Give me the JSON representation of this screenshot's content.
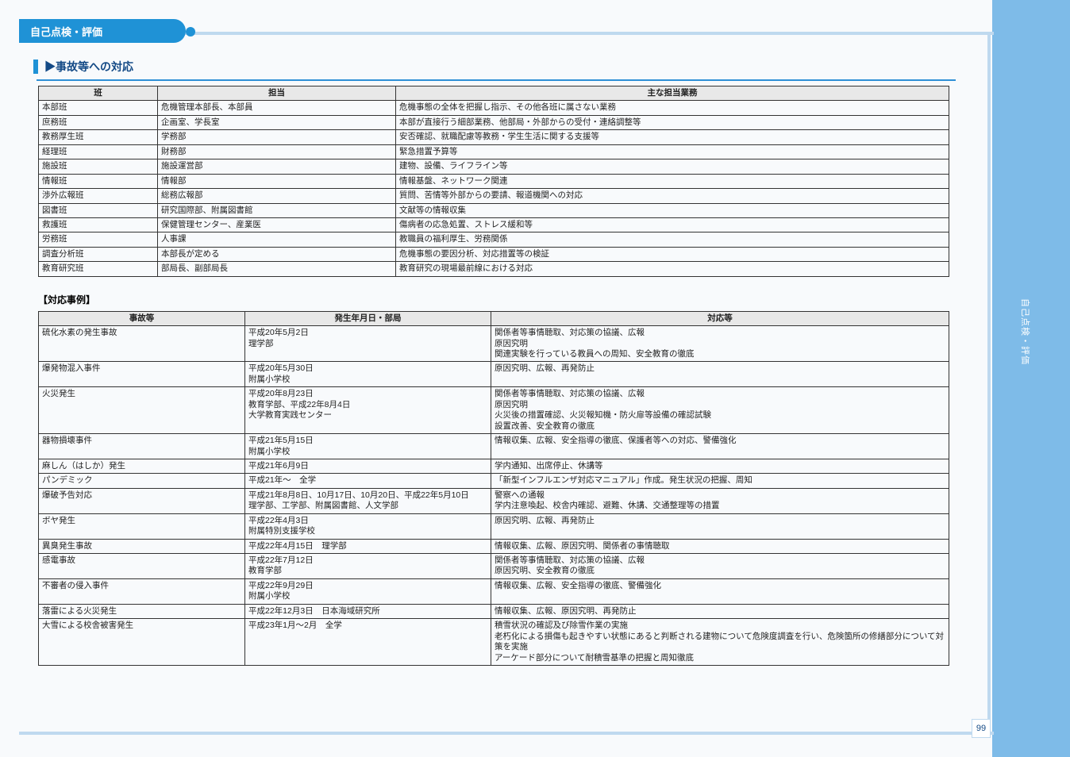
{
  "tab_label": "自己点検・評価",
  "side_label": "自己点検・評価",
  "page_number": "99",
  "section": {
    "title": "▶事故等への対応",
    "table_header": [
      "班",
      "担当",
      "主な担当業務"
    ],
    "rows": [
      [
        "本部班",
        "危機管理本部長、本部員",
        "危機事態の全体を把握し指示、その他各班に属さない業務"
      ],
      [
        "庶務班",
        "企画室、学長室",
        "本部が直接行う細部業務、他部局・外部からの受付・連絡調整等"
      ],
      [
        "教務厚生班",
        "学務部",
        "安否確認、就職配慮等教務・学生生活に関する支援等"
      ],
      [
        "経理班",
        "財務部",
        "緊急措置予算等"
      ],
      [
        "施設班",
        "施設運営部",
        "建物、設備、ライフライン等"
      ],
      [
        "情報班",
        "情報部",
        "情報基盤、ネットワーク関連"
      ],
      [
        "渉外広報班",
        "総務広報部",
        "質問、苦情等外部からの要請、報道機関への対応"
      ],
      [
        "図書班",
        "研究国際部、附属図書館",
        "文献等の情報収集"
      ],
      [
        "救護班",
        "保健管理センター、産業医",
        "傷病者の応急処置、ストレス緩和等"
      ],
      [
        "労務班",
        "人事課",
        "教職員の福利厚生、労務関係"
      ],
      [
        "調査分析班",
        "本部長が定める",
        "危機事態の要因分析、対応措置等の検証"
      ],
      [
        "教育研究班",
        "部局長、副部局長",
        "教育研究の現場最前線における対応"
      ]
    ]
  },
  "subhead": "【対応事例】",
  "table2": {
    "header": [
      "事故等",
      "発生年月日・部局",
      "対応等"
    ],
    "rows": [
      [
        "硫化水素の発生事故",
        "平成20年5月2日\n理学部",
        "関係者等事情聴取、対応策の協議、広報\n原因究明\n関連実験を行っている教員への周知、安全教育の徹底"
      ],
      [
        "爆発物混入事件",
        "平成20年5月30日\n附属小学校",
        "原因究明、広報、再発防止"
      ],
      [
        "火災発生",
        "平成20年8月23日\n教育学部、平成22年8月4日\n大学教育実践センター",
        "関係者等事情聴取、対応策の協議、広報\n原因究明\n火災後の措置確認、火災報知機・防火扉等設備の確認試験\n設置改善、安全教育の徹底"
      ],
      [
        "器物損壊事件",
        "平成21年5月15日\n附属小学校",
        "情報収集、広報、安全指導の徹底、保護者等への対応、警備強化"
      ],
      [
        "麻しん（はしか）発生",
        "平成21年6月9日",
        "学内通知、出席停止、休講等"
      ],
      [
        "パンデミック",
        "平成21年～　全学",
        "「新型インフルエンザ対応マニュアル」作成。発生状況の把握、周知"
      ],
      [
        "爆破予告対応",
        "平成21年8月8日、10月17日、10月20日、平成22年5月10日\n理学部、工学部、附属図書館、人文学部",
        "警察への通報\n学内注意喚起、校舎内確認、避難、休講、交通整理等の措置"
      ],
      [
        "ボヤ発生",
        "平成22年4月3日\n附属特別支援学校",
        "原因究明、広報、再発防止"
      ],
      [
        "異臭発生事故",
        "平成22年4月15日　理学部",
        "情報収集、広報、原因究明、関係者の事情聴取"
      ],
      [
        "感電事故",
        "平成22年7月12日\n教育学部",
        "関係者等事情聴取、対応策の協議、広報\n原因究明、安全教育の徹底"
      ],
      [
        "不審者の侵入事件",
        "平成22年9月29日\n附属小学校",
        "情報収集、広報、安全指導の徹底、警備強化"
      ],
      [
        "落雷による火災発生",
        "平成22年12月3日　日本海域研究所",
        "情報収集、広報、原因究明、再発防止"
      ],
      [
        "大雪による校舎被害発生",
        "平成23年1月～2月　全学",
        "積雪状況の確認及び除雪作業の実施\n老朽化による損傷も起きやすい状態にあると判断される建物について危険度調査を行い、危険箇所の修繕部分について対策を実施\nアーケード部分について耐積雪基準の把握と周知徹底"
      ]
    ]
  }
}
